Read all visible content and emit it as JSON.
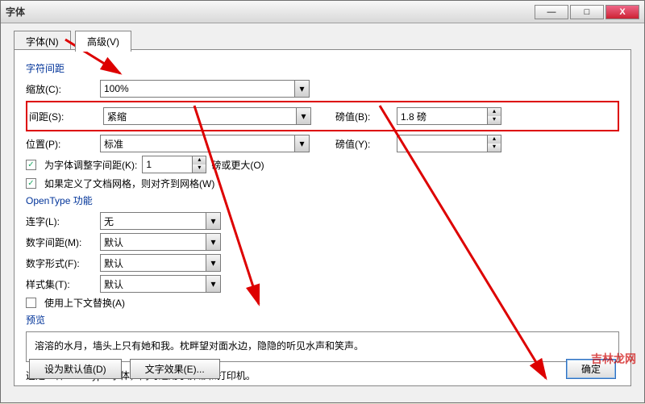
{
  "window": {
    "title": "字体"
  },
  "winbtns": {
    "min": "—",
    "max": "□",
    "close": "X"
  },
  "tabs": {
    "font": "字体(N)",
    "advanced": "高级(V)"
  },
  "section": {
    "charSpacing": "字符间距",
    "opentype": "OpenType 功能",
    "preview": "预览"
  },
  "labels": {
    "scale": "缩放(C):",
    "spacing": "间距(S):",
    "points": "磅值(B):",
    "position": "位置(P):",
    "pointsY": "磅值(Y):",
    "kerning": "为字体调整字间距(K):",
    "kerningUnit": "磅或更大(O)",
    "snapGrid": "如果定义了文档网格，则对齐到网格(W)",
    "ligatures": "连字(L):",
    "numSpacing": "数字间距(M):",
    "numForm": "数字形式(F):",
    "styleSet": "样式集(T):",
    "contextAlt": "使用上下文替换(A)"
  },
  "values": {
    "scale": "100%",
    "spacing": "紧缩",
    "points": "1.8 磅",
    "position": "标准",
    "pointsY": "",
    "kerning": "1",
    "ligatures": "无",
    "numSpacing": "默认",
    "numForm": "默认",
    "styleSet": "默认"
  },
  "checks": {
    "kerning": "✓",
    "snapGrid": "✓",
    "contextAlt": ""
  },
  "preview": {
    "text": "溶溶的水月，墙头上只有她和我。枕畔望对面水边，隐隐的听见水声和笑声。",
    "note": "这是一种 TrueType 字体，同时适用于屏幕和打印机。"
  },
  "buttons": {
    "default": "设为默认值(D)",
    "textfx": "文字效果(E)...",
    "ok": "确定"
  },
  "glyphs": {
    "down": "▾",
    "up": "▴"
  },
  "watermark": "吉林龙网"
}
